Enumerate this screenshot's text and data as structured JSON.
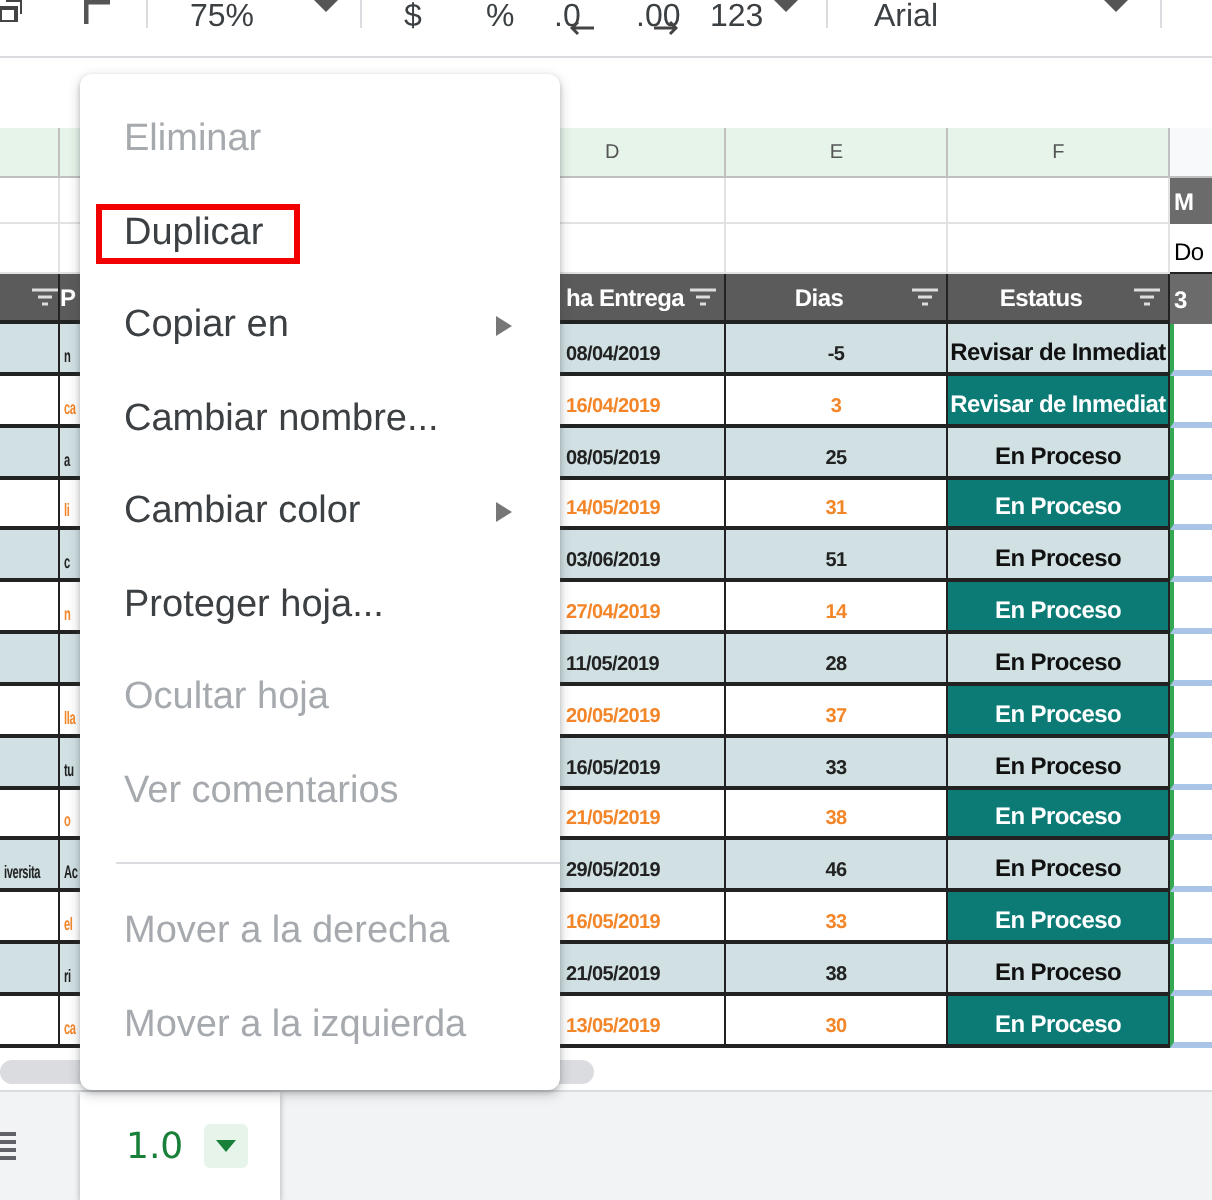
{
  "toolbar": {
    "zoom": "75%",
    "currency": "$",
    "percent": "%",
    "decrease_decimals": ".0",
    "increase_decimals": ".00",
    "number_format": "123",
    "font": "Arial"
  },
  "grid": {
    "column_letters": [
      "D",
      "E",
      "F"
    ],
    "side_column": {
      "title": "M",
      "subtitle": "Do",
      "header": "3"
    },
    "header": {
      "column_2": "P",
      "delivery_date": "ha Entrega",
      "days": "Dias",
      "status": "Estatus"
    },
    "rows": [
      {
        "column_2": "n",
        "date": "08/04/2019",
        "days": "-5",
        "status": "Revisar de Inmediat",
        "accent": false
      },
      {
        "column_2": "ca",
        "date": "16/04/2019",
        "days": "3",
        "status": "Revisar de Inmediat",
        "accent": true
      },
      {
        "column_2": "a",
        "date": "08/05/2019",
        "days": "25",
        "status": "En Proceso",
        "accent": false
      },
      {
        "column_2": "li",
        "date": "14/05/2019",
        "days": "31",
        "status": "En Proceso",
        "accent": true
      },
      {
        "column_2": "c",
        "date": "03/06/2019",
        "days": "51",
        "status": "En Proceso",
        "accent": false
      },
      {
        "column_2": "n",
        "date": "27/04/2019",
        "days": "14",
        "status": "En Proceso",
        "accent": true
      },
      {
        "date": "11/05/2019",
        "days": "28",
        "status": "En Proceso",
        "accent": false
      },
      {
        "column_2": "lla",
        "date": "20/05/2019",
        "days": "37",
        "status": "En Proceso",
        "accent": true
      },
      {
        "column_2": "tu",
        "date": "16/05/2019",
        "days": "33",
        "status": "En Proceso",
        "accent": false
      },
      {
        "column_2": "o",
        "date": "21/05/2019",
        "days": "38",
        "status": "En Proceso",
        "accent": true
      },
      {
        "column_1": "iversita",
        "column_2": "Ac",
        "date": "29/05/2019",
        "days": "46",
        "status": "En Proceso",
        "accent": false
      },
      {
        "column_2": "el",
        "date": "16/05/2019",
        "days": "33",
        "status": "En Proceso",
        "accent": true
      },
      {
        "column_2": "ri",
        "date": "21/05/2019",
        "days": "38",
        "status": "En Proceso",
        "accent": false
      },
      {
        "column_2": "ca",
        "date": "13/05/2019",
        "days": "30",
        "status": "En Proceso",
        "accent": true
      }
    ]
  },
  "menu": {
    "items": [
      {
        "label": "Eliminar",
        "disabled": true,
        "submenu": false,
        "highlighted": false,
        "divider_before": false
      },
      {
        "label": "Duplicar",
        "disabled": false,
        "submenu": false,
        "highlighted": true,
        "divider_before": false
      },
      {
        "label": "Copiar en",
        "disabled": false,
        "submenu": true,
        "highlighted": false,
        "divider_before": false
      },
      {
        "label": "Cambiar nombre...",
        "disabled": false,
        "submenu": false,
        "highlighted": false,
        "divider_before": false
      },
      {
        "label": "Cambiar color",
        "disabled": false,
        "submenu": true,
        "highlighted": false,
        "divider_before": false
      },
      {
        "label": "Proteger hoja...",
        "disabled": false,
        "submenu": false,
        "highlighted": false,
        "divider_before": false
      },
      {
        "label": "Ocultar hoja",
        "disabled": true,
        "submenu": false,
        "highlighted": false,
        "divider_before": false
      },
      {
        "label": "Ver comentarios",
        "disabled": true,
        "submenu": false,
        "highlighted": false,
        "divider_before": false
      },
      {
        "label": "Mover a la derecha",
        "disabled": true,
        "submenu": false,
        "highlighted": false,
        "divider_before": true
      },
      {
        "label": "Mover a la izquierda",
        "disabled": true,
        "submenu": false,
        "highlighted": false,
        "divider_before": false
      }
    ]
  },
  "sheet_tabs": [
    {
      "label": "1.0",
      "selected": true
    }
  ]
}
